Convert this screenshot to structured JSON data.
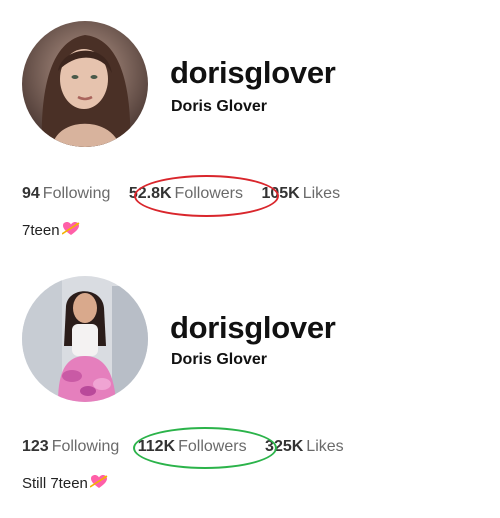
{
  "profiles": [
    {
      "username": "dorisglover",
      "display_name": "Doris Glover",
      "following_count": "94",
      "following_label": "Following",
      "followers_count": "52.8K",
      "followers_label": "Followers",
      "likes_count": "105K",
      "likes_label": "Likes",
      "bio": "7teen",
      "highlight_color": "#d9262c"
    },
    {
      "username": "dorisglover",
      "display_name": "Doris Glover",
      "following_count": "123",
      "following_label": "Following",
      "followers_count": "112K",
      "followers_label": "Followers",
      "likes_count": "325K",
      "likes_label": "Likes",
      "bio": "Still 7teen",
      "highlight_color": "#2bb34a"
    }
  ],
  "icons": {
    "bio_emoji": "heart-with-arrow-icon"
  }
}
